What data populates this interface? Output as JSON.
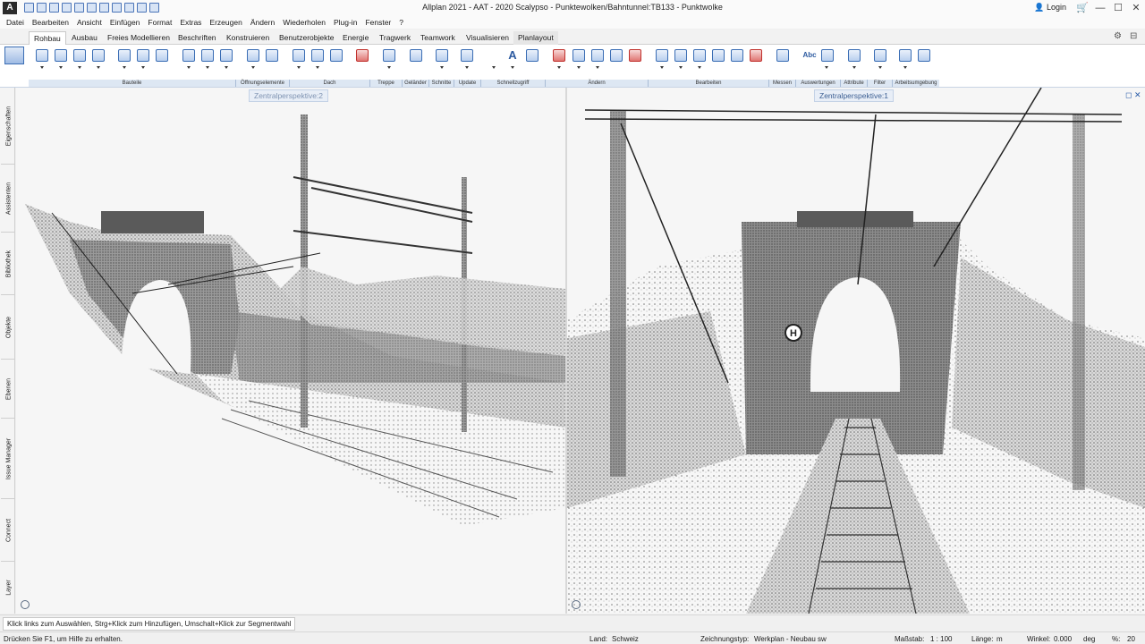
{
  "app": {
    "title": "Allplan 2021 - AAT - 2020 Scalypso - Punktewolken/Bahntunnel:TB133 - Punktwolke",
    "logo": "A",
    "login_label": "Login",
    "window_controls": {
      "minimize": "—",
      "maximize": "☐",
      "close": "✕"
    }
  },
  "menu": [
    "Datei",
    "Bearbeiten",
    "Ansicht",
    "Einfügen",
    "Format",
    "Extras",
    "Erzeugen",
    "Ändern",
    "Wiederholen",
    "Plug-in",
    "Fenster",
    "?"
  ],
  "tabs": [
    {
      "label": "Rohbau",
      "active": true
    },
    {
      "label": "Ausbau"
    },
    {
      "label": "Freies Modellieren"
    },
    {
      "label": "Beschriften"
    },
    {
      "label": "Konstruieren"
    },
    {
      "label": "Benutzerobjekte"
    },
    {
      "label": "Energie"
    },
    {
      "label": "Tragwerk"
    },
    {
      "label": "Teamwork"
    },
    {
      "label": "Visualisieren"
    },
    {
      "label": "Planlayout",
      "highlight": true
    }
  ],
  "ribbon_groups": [
    "Bauteile",
    "Öffnungselemente",
    "Dach",
    "Treppe",
    "Geländer",
    "Schnitte",
    "Update",
    "Schnellzugriff",
    "Ändern",
    "Bearbeiten",
    "Messen",
    "Auswertungen",
    "Attribute",
    "Filter",
    "Arbeitsumgebung"
  ],
  "ribbon_text_icons": {
    "text_tool": "A",
    "abc_tool": "Abc"
  },
  "ribbon_right_icons": {
    "settings": "⚙",
    "expand": "⊟"
  },
  "sidebar_tabs": [
    "Eigenschaften",
    "Assistenten",
    "Bibliothek",
    "Objekte",
    "Ebenen",
    "Issue Manager",
    "Connect",
    "Layer"
  ],
  "viewports": {
    "left_label": "Zentralperspektive:2",
    "right_label": "Zentralperspektive:1",
    "right_controls": {
      "maximize": "◻",
      "close": "✕"
    },
    "sign_letter": "H"
  },
  "hint": "Klick links zum Auswählen, Strg+Klick zum Hinzufügen, Umschalt+Klick zur Segmentwahl",
  "status": {
    "help": "Drücken Sie F1, um Hilfe zu erhalten.",
    "land_label": "Land:",
    "land_value": "Schweiz",
    "zeichnungstyp_label": "Zeichnungstyp:",
    "zeichnungstyp_value": "Werkplan - Neubau sw",
    "massstab_label": "Maßstab:",
    "massstab_value": "1 : 100",
    "laenge_label": "Länge:",
    "laenge_value": "m",
    "winkel_label": "Winkel:",
    "winkel_value": "0.000",
    "winkel_unit": "deg",
    "percent_label": "%:",
    "percent_value": "20"
  }
}
